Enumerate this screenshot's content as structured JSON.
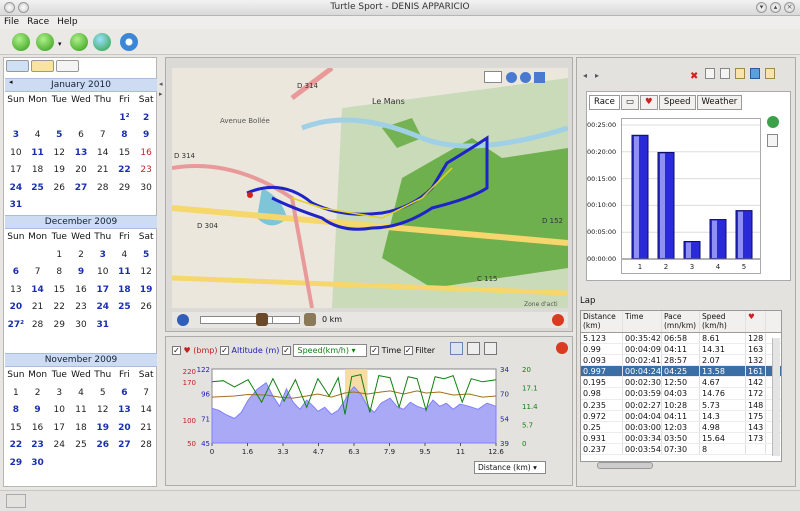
{
  "window": {
    "title": "Turtle Sport - DENIS APPARICIO"
  },
  "menu": [
    "File",
    "Race",
    "Help"
  ],
  "colors": {
    "highlight": "#cddcf2",
    "track": "#1f24c8",
    "bar": "#2a2ad8",
    "selection": "#3a6ea5"
  },
  "calendar": {
    "weekdays": [
      "Sun",
      "Mon",
      "Tue",
      "Wed",
      "Thu",
      "Fri",
      "Sat"
    ],
    "months": [
      {
        "title": "January 2010",
        "rows": [
          [
            [
              "",
              ""
            ],
            [
              "",
              ""
            ],
            [
              "",
              ""
            ],
            [
              "",
              ""
            ],
            [
              "",
              ""
            ],
            [
              "1²",
              "b"
            ],
            [
              "2",
              "b"
            ]
          ],
          [
            [
              "3",
              "b"
            ],
            [
              "4",
              "d"
            ],
            [
              "5",
              "b"
            ],
            [
              "6",
              "d"
            ],
            [
              "7",
              "d"
            ],
            [
              "8",
              "b"
            ],
            [
              "9",
              "b"
            ]
          ],
          [
            [
              "10",
              "d"
            ],
            [
              "11",
              "b"
            ],
            [
              "12",
              "d"
            ],
            [
              "13",
              "b"
            ],
            [
              "14",
              "d"
            ],
            [
              "15",
              "d"
            ],
            [
              "16",
              "r"
            ]
          ],
          [
            [
              "17",
              "d"
            ],
            [
              "18",
              "d"
            ],
            [
              "19",
              "d"
            ],
            [
              "20",
              "d"
            ],
            [
              "21",
              "d"
            ],
            [
              "22",
              "b"
            ],
            [
              "23",
              "r"
            ]
          ],
          [
            [
              "24",
              "b"
            ],
            [
              "25",
              "b"
            ],
            [
              "26",
              "d"
            ],
            [
              "27",
              "b"
            ],
            [
              "28",
              "d"
            ],
            [
              "29",
              "d"
            ],
            [
              "30",
              "d"
            ]
          ],
          [
            [
              "31",
              "b"
            ],
            [
              "",
              ""
            ],
            [
              "",
              ""
            ],
            [
              "",
              ""
            ],
            [
              "",
              ""
            ],
            [
              "",
              ""
            ],
            [
              "",
              ""
            ]
          ]
        ]
      },
      {
        "title": "December 2009",
        "rows": [
          [
            [
              "",
              ""
            ],
            [
              "",
              ""
            ],
            [
              "1",
              "d"
            ],
            [
              "2",
              "d"
            ],
            [
              "3",
              "b"
            ],
            [
              "4",
              "d"
            ],
            [
              "5",
              "b"
            ]
          ],
          [
            [
              "6",
              "b"
            ],
            [
              "7",
              "d"
            ],
            [
              "8",
              "d"
            ],
            [
              "9",
              "b"
            ],
            [
              "10",
              "d"
            ],
            [
              "11",
              "b"
            ],
            [
              "12",
              "d"
            ]
          ],
          [
            [
              "13",
              "d"
            ],
            [
              "14",
              "b"
            ],
            [
              "15",
              "d"
            ],
            [
              "16",
              "d"
            ],
            [
              "17",
              "b"
            ],
            [
              "18",
              "b"
            ],
            [
              "19",
              "b"
            ]
          ],
          [
            [
              "20",
              "b"
            ],
            [
              "21",
              "d"
            ],
            [
              "22",
              "d"
            ],
            [
              "23",
              "d"
            ],
            [
              "24",
              "b"
            ],
            [
              "25",
              "b"
            ],
            [
              "26",
              "d"
            ]
          ],
          [
            [
              "27²",
              "b"
            ],
            [
              "28",
              "d"
            ],
            [
              "29",
              "d"
            ],
            [
              "30",
              "d"
            ],
            [
              "31",
              "b"
            ],
            [
              "",
              ""
            ],
            [
              "",
              ""
            ]
          ]
        ]
      },
      {
        "title": "November 2009",
        "rows": [
          [
            [
              "1",
              "d"
            ],
            [
              "2",
              "d"
            ],
            [
              "3",
              "d"
            ],
            [
              "4",
              "d"
            ],
            [
              "5",
              "d"
            ],
            [
              "6",
              "b"
            ],
            [
              "7",
              "d"
            ]
          ],
          [
            [
              "8",
              "b"
            ],
            [
              "9",
              "b"
            ],
            [
              "10",
              "d"
            ],
            [
              "11",
              "d"
            ],
            [
              "12",
              "d"
            ],
            [
              "13",
              "b"
            ],
            [
              "14",
              "d"
            ]
          ],
          [
            [
              "15",
              "d"
            ],
            [
              "16",
              "d"
            ],
            [
              "17",
              "d"
            ],
            [
              "18",
              "d"
            ],
            [
              "19",
              "b"
            ],
            [
              "20",
              "b"
            ],
            [
              "21",
              "d"
            ]
          ],
          [
            [
              "22",
              "b"
            ],
            [
              "23",
              "b"
            ],
            [
              "24",
              "d"
            ],
            [
              "25",
              "d"
            ],
            [
              "26",
              "b"
            ],
            [
              "27",
              "b"
            ],
            [
              "28",
              "d"
            ]
          ],
          [
            [
              "29",
              "b"
            ],
            [
              "30",
              "b"
            ],
            [
              "",
              ""
            ],
            [
              "",
              ""
            ],
            [
              "",
              ""
            ],
            [
              "",
              ""
            ],
            [
              "",
              ""
            ]
          ]
        ]
      }
    ]
  },
  "map": {
    "labels": [
      "Le Mans",
      "D 314",
      "D 314",
      "D 304",
      "D 152",
      "C 115",
      "Avenue Bollée",
      "Zone d'acti"
    ],
    "distance_readout": "0 km"
  },
  "chart_controls": {
    "hr_label": "♥ (bmp)",
    "altitude_label": "Altitude (m)",
    "speed_select": "Speed(km/h)",
    "time_label": "Time",
    "filter_label": "Filter",
    "xaxis_select": "Distance (km)"
  },
  "chart_data": {
    "type": "line",
    "x_ticks": [
      "0",
      "1.6",
      "3.3",
      "4.7",
      "6.3",
      "7.9",
      "9.5",
      "11",
      "12.6"
    ],
    "left_ticks_hr": [
      "220",
      "170",
      "100",
      "50"
    ],
    "left_ticks_alt": [
      "122",
      "96",
      "71",
      "45"
    ],
    "right_ticks_speed": [
      "34",
      "70",
      "54",
      "39"
    ],
    "right_ticks_pace": [
      "20",
      "17.1",
      "11.4",
      "5.7",
      "0"
    ],
    "xlim": [
      0,
      12.6
    ],
    "series": [
      {
        "color": "#8080ff",
        "x": [
          0,
          0.3,
          0.6,
          1.0,
          1.3,
          1.6,
          2.0,
          2.4,
          2.7,
          3.0,
          3.3,
          3.6,
          3.9,
          4.2,
          4.5,
          4.7,
          5.0,
          5.3,
          5.6,
          5.9,
          6.1,
          6.3,
          6.6,
          6.9,
          7.2,
          7.5,
          7.9,
          8.2,
          8.5,
          8.8,
          9.1,
          9.5,
          9.8,
          10.1,
          10.4,
          10.7,
          11.0,
          11.4,
          11.8,
          12.2,
          12.6
        ],
        "y": [
          108,
          104,
          96,
          88,
          100,
          124,
          145,
          158,
          132,
          112,
          146,
          120,
          106,
          124,
          112,
          102,
          110,
          96,
          104,
          124,
          140,
          150,
          136,
          112,
          100,
          118,
          128,
          112,
          106,
          120,
          112,
          106,
          124,
          112,
          118,
          106,
          116,
          112,
          106,
          118,
          112
        ]
      },
      {
        "color": "#a07020",
        "x": [
          0,
          1.0,
          1.6,
          2.4,
          3.0,
          3.6,
          4.2,
          4.7,
          5.3,
          5.9,
          6.3,
          6.9,
          7.5,
          7.9,
          8.5,
          9.1,
          9.5,
          10.1,
          10.7,
          11.4,
          12.0,
          12.6
        ],
        "y": [
          130,
          132,
          135,
          134,
          130,
          128,
          132,
          136,
          130,
          138,
          140,
          136,
          140,
          142,
          136,
          142,
          138,
          140,
          134,
          136,
          130,
          132
        ]
      },
      {
        "color": "#108010",
        "x": [
          0,
          0.5,
          1.0,
          1.6,
          2.2,
          2.7,
          3.2,
          3.7,
          4.2,
          4.7,
          5.2,
          5.6,
          5.9,
          6.2,
          6.6,
          7.0,
          7.4,
          7.9,
          8.3,
          8.7,
          9.1,
          9.5,
          9.9,
          10.3,
          10.7,
          11.1,
          11.5,
          12.0,
          12.6
        ],
        "y": [
          160,
          162,
          150,
          164,
          120,
          166,
          122,
          164,
          110,
          166,
          132,
          168,
          96,
          170,
          174,
          100,
          172,
          168,
          110,
          170,
          166,
          104,
          170,
          166,
          172,
          120,
          166,
          160,
          164
        ]
      }
    ]
  },
  "lap_chart": {
    "type": "bar",
    "categories": [
      "1",
      "2",
      "3",
      "4",
      "5"
    ],
    "values_seconds": [
      1662,
      1431,
      235,
      530,
      650
    ],
    "y_ticks": [
      "00:25:00",
      "00:20:00",
      "00:15:00",
      "00:10:00",
      "00:05:00",
      "00:00:00"
    ],
    "ylim": [
      0,
      1800
    ]
  },
  "right_tabs": [
    "Race",
    "",
    "",
    "Speed",
    "Weather"
  ],
  "lap_label": "Lap",
  "lap_table": {
    "headers": [
      "Distance (km)",
      "Time",
      "Pace (mn/km)",
      "Speed (km/h)",
      "♥"
    ],
    "rows": [
      [
        "5.123",
        "00:35:42",
        "06:58",
        "8.61",
        "128"
      ],
      [
        "0.99",
        "00:04:09",
        "04:11",
        "14.31",
        "163"
      ],
      [
        "0.093",
        "00:02:41",
        "28:57",
        "2.07",
        "132"
      ],
      [
        "0.997",
        "00:04:24",
        "04:25",
        "13.58",
        "161"
      ],
      [
        "0.195",
        "00:02:30",
        "12:50",
        "4.67",
        "142"
      ],
      [
        "0.98",
        "00:03:59",
        "04:03",
        "14.76",
        "172"
      ],
      [
        "0.235",
        "00:02:27",
        "10:28",
        "5.73",
        "148"
      ],
      [
        "0.972",
        "00:04:04",
        "04:11",
        "14.3",
        "175"
      ],
      [
        "0.25",
        "00:03:00",
        "12:03",
        "4.98",
        "143"
      ],
      [
        "0.931",
        "00:03:34",
        "03:50",
        "15.64",
        "173"
      ],
      [
        "0.237",
        "00:03:54",
        "07:30",
        "8",
        ""
      ]
    ],
    "selected_index": 3
  }
}
